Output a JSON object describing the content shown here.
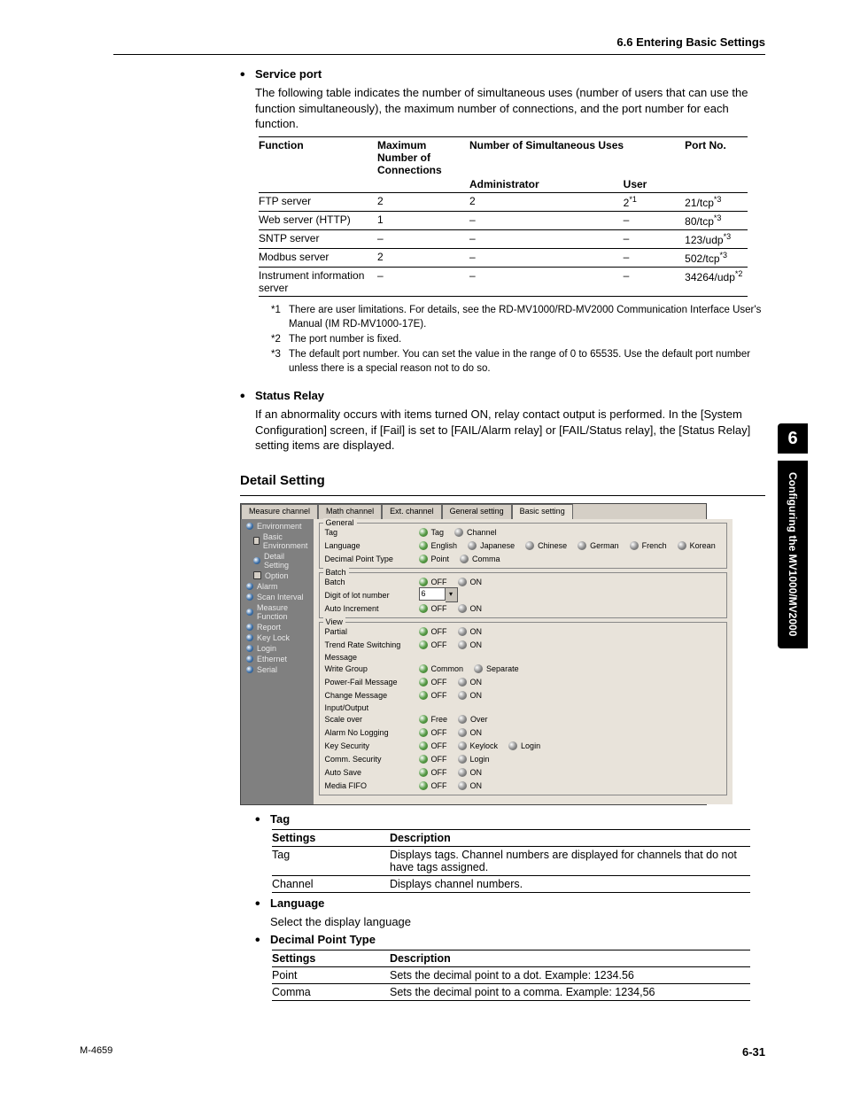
{
  "header": {
    "section": "6.6  Entering Basic Settings"
  },
  "sidetab": {
    "num": "6",
    "text": "Configuring the MV1000/MV2000"
  },
  "footer": {
    "left": "M-4659",
    "right": "6-31"
  },
  "service_port": {
    "heading": "Service port",
    "para": "The following table indicates the number of simultaneous uses (number of users that can use the function simultaneously), the maximum number of connections, and the port number for each function.",
    "table": {
      "headers": {
        "c1": "Function",
        "c2": "Maximum Number of Connections",
        "c3a": "Number of Simultaneous Uses",
        "c3b_admin": "Administrator",
        "c3b_user": "User",
        "c4": "Port No."
      },
      "rows": [
        {
          "func": "FTP server",
          "max": "2",
          "admin": "2",
          "user": "2",
          "user_sup": "*1",
          "port": "21/tcp",
          "port_sup": "*3"
        },
        {
          "func": "Web server (HTTP)",
          "max": "1",
          "admin": "–",
          "user": "–",
          "user_sup": "",
          "port": "80/tcp",
          "port_sup": "*3"
        },
        {
          "func": "SNTP server",
          "max": "–",
          "admin": "–",
          "user": "–",
          "user_sup": "",
          "port": "123/udp",
          "port_sup": "*3"
        },
        {
          "func": "Modbus server",
          "max": "2",
          "admin": "–",
          "user": "–",
          "user_sup": "",
          "port": "502/tcp",
          "port_sup": "*3"
        },
        {
          "func": "Instrument information server",
          "max": "–",
          "admin": "–",
          "user": "–",
          "user_sup": "",
          "port": "34264/udp",
          "port_sup": "*2"
        }
      ]
    },
    "notes": [
      {
        "lab": "*1",
        "text": "There are user limitations.  For details, see the RD-MV1000/RD-MV2000 Communication Interface User's Manual (IM RD-MV1000-17E)."
      },
      {
        "lab": "*2",
        "text": "The port number is fixed."
      },
      {
        "lab": "*3",
        "text": "The default port number. You can set the value in the range of 0 to 65535. Use the default port number unless there is a special reason not to do so."
      }
    ]
  },
  "status_relay": {
    "heading": "Status Relay",
    "para": "If an abnormality occurs with items turned ON, relay contact output is performed. In the [System Configuration] screen, if [Fail] is set to [FAIL/Alarm relay] or [FAIL/Status relay], the [Status Relay] setting items are displayed."
  },
  "detail_setting": {
    "heading": "Detail Setting",
    "tabs": [
      "Measure channel",
      "Math channel",
      "Ext. channel",
      "General setting",
      "Basic setting"
    ],
    "tree": [
      {
        "type": "r",
        "label": "Environment",
        "sub": false
      },
      {
        "type": "c",
        "label": "Basic Environment",
        "sub": true
      },
      {
        "type": "r",
        "label": "Detail Setting",
        "sub": true
      },
      {
        "type": "c",
        "label": "Option",
        "sub": true
      },
      {
        "type": "r",
        "label": "Alarm",
        "sub": false
      },
      {
        "type": "r",
        "label": "Scan Interval",
        "sub": false
      },
      {
        "type": "r",
        "label": "Measure Function",
        "sub": false
      },
      {
        "type": "r",
        "label": "Report",
        "sub": false
      },
      {
        "type": "r",
        "label": "Key Lock",
        "sub": false
      },
      {
        "type": "r",
        "label": "Login",
        "sub": false
      },
      {
        "type": "r",
        "label": "Ethernet",
        "sub": false
      },
      {
        "type": "r",
        "label": "Serial",
        "sub": false
      }
    ],
    "general": {
      "legend": "General",
      "tag_label": "Tag",
      "tag_opts": [
        "Tag",
        "Channel"
      ],
      "tag_sel": 0,
      "lang_label": "Language",
      "lang_opts": [
        "English",
        "Japanese",
        "Chinese",
        "German",
        "French",
        "Korean"
      ],
      "lang_sel": 0,
      "dp_label": "Decimal Point Type",
      "dp_opts": [
        "Point",
        "Comma"
      ],
      "dp_sel": 0
    },
    "batch": {
      "legend": "Batch",
      "b_label": "Batch",
      "b_opts": [
        "OFF",
        "ON"
      ],
      "b_sel": 0,
      "d_label": "Digit of lot number",
      "d_val": "6",
      "a_label": "Auto Increment",
      "a_opts": [
        "OFF",
        "ON"
      ],
      "a_sel": 0
    },
    "view": {
      "legend": "View",
      "p_label": "Partial",
      "p_opts": [
        "OFF",
        "ON"
      ],
      "p_sel": 0,
      "t_label": "Trend Rate Switching",
      "t_opts": [
        "OFF",
        "ON"
      ],
      "t_sel": 0,
      "msg": "Message",
      "w_label": "Write Group",
      "w_opts": [
        "Common",
        "Separate"
      ],
      "w_sel": 0,
      "pf_label": "Power-Fail Message",
      "pf_opts": [
        "OFF",
        "ON"
      ],
      "pf_sel": 0,
      "cm_label": "Change Message",
      "cm_opts": [
        "OFF",
        "ON"
      ],
      "cm_sel": 0,
      "io": "Input/Output",
      "so_label": "Scale over",
      "so_opts": [
        "Free",
        "Over"
      ],
      "so_sel": 0,
      "an_label": "Alarm No Logging",
      "an_opts": [
        "OFF",
        "ON"
      ],
      "an_sel": 0,
      "ks_label": "Key Security",
      "ks_opts": [
        "OFF",
        "Keylock",
        "Login"
      ],
      "ks_sel": 0,
      "cs_label": "Comm. Security",
      "cs_opts": [
        "OFF",
        "Login"
      ],
      "cs_sel": 0,
      "as_label": "Auto Save",
      "as_opts": [
        "OFF",
        "ON"
      ],
      "as_sel": 0,
      "mf_label": "Media FIFO",
      "mf_opts": [
        "OFF",
        "ON"
      ],
      "mf_sel": 0
    }
  },
  "tag_section": {
    "heading": "Tag",
    "headers": {
      "c1": "Settings",
      "c2": "Description"
    },
    "rows": [
      {
        "s": "Tag",
        "d": "Displays tags.  Channel numbers are displayed for channels that do not have tags assigned."
      },
      {
        "s": "Channel",
        "d": "Displays channel numbers."
      }
    ]
  },
  "language_section": {
    "heading": "Language",
    "para": "Select the display language"
  },
  "decimal_section": {
    "heading": "Decimal Point Type",
    "headers": {
      "c1": "Settings",
      "c2": "Description"
    },
    "rows": [
      {
        "s": "Point",
        "d": "Sets the decimal point to a dot. Example: 1234.56"
      },
      {
        "s": "Comma",
        "d": "Sets the decimal point to a comma. Example: 1234,56"
      }
    ]
  }
}
